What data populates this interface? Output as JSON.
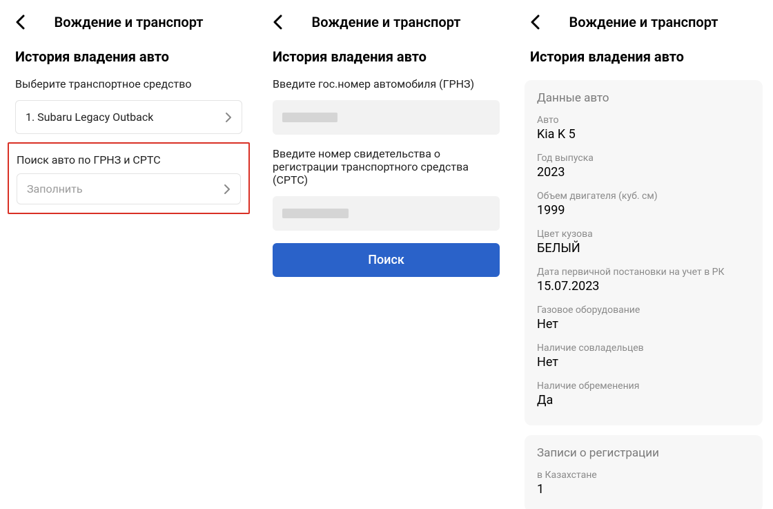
{
  "header_title": "Вождение и транспорт",
  "section_title": "История владения авто",
  "screen1": {
    "select_label": "Выберите транспортное средство",
    "select_value": "1. Subaru Legacy Outback",
    "search_label": "Поиск авто по ГРНЗ и СРТС",
    "fill_text": "Заполнить"
  },
  "screen2": {
    "grnz_label": "Введите гос.номер автомобиля (ГРНЗ)",
    "srts_label": "Введите номер свидетельства о регистрации транспортного средства (СРТС)",
    "search_button": "Поиск"
  },
  "screen3": {
    "card1_title": "Данные авто",
    "rows": [
      {
        "label": "Авто",
        "value": "Kia K 5"
      },
      {
        "label": "Год выпуска",
        "value": "2023"
      },
      {
        "label": "Объем двигателя (куб. см)",
        "value": "1999"
      },
      {
        "label": "Цвет кузова",
        "value": "БЕЛЫЙ"
      },
      {
        "label": "Дата первичной постановки на учет в РК",
        "value": "15.07.2023"
      },
      {
        "label": "Газовое оборудование",
        "value": "Нет"
      },
      {
        "label": "Наличие совладельцев",
        "value": "Нет"
      },
      {
        "label": "Наличие обременения",
        "value": "Да"
      }
    ],
    "card2_title": "Записи о регистрации",
    "reg_label": "в Казахстане",
    "reg_value": "1"
  }
}
